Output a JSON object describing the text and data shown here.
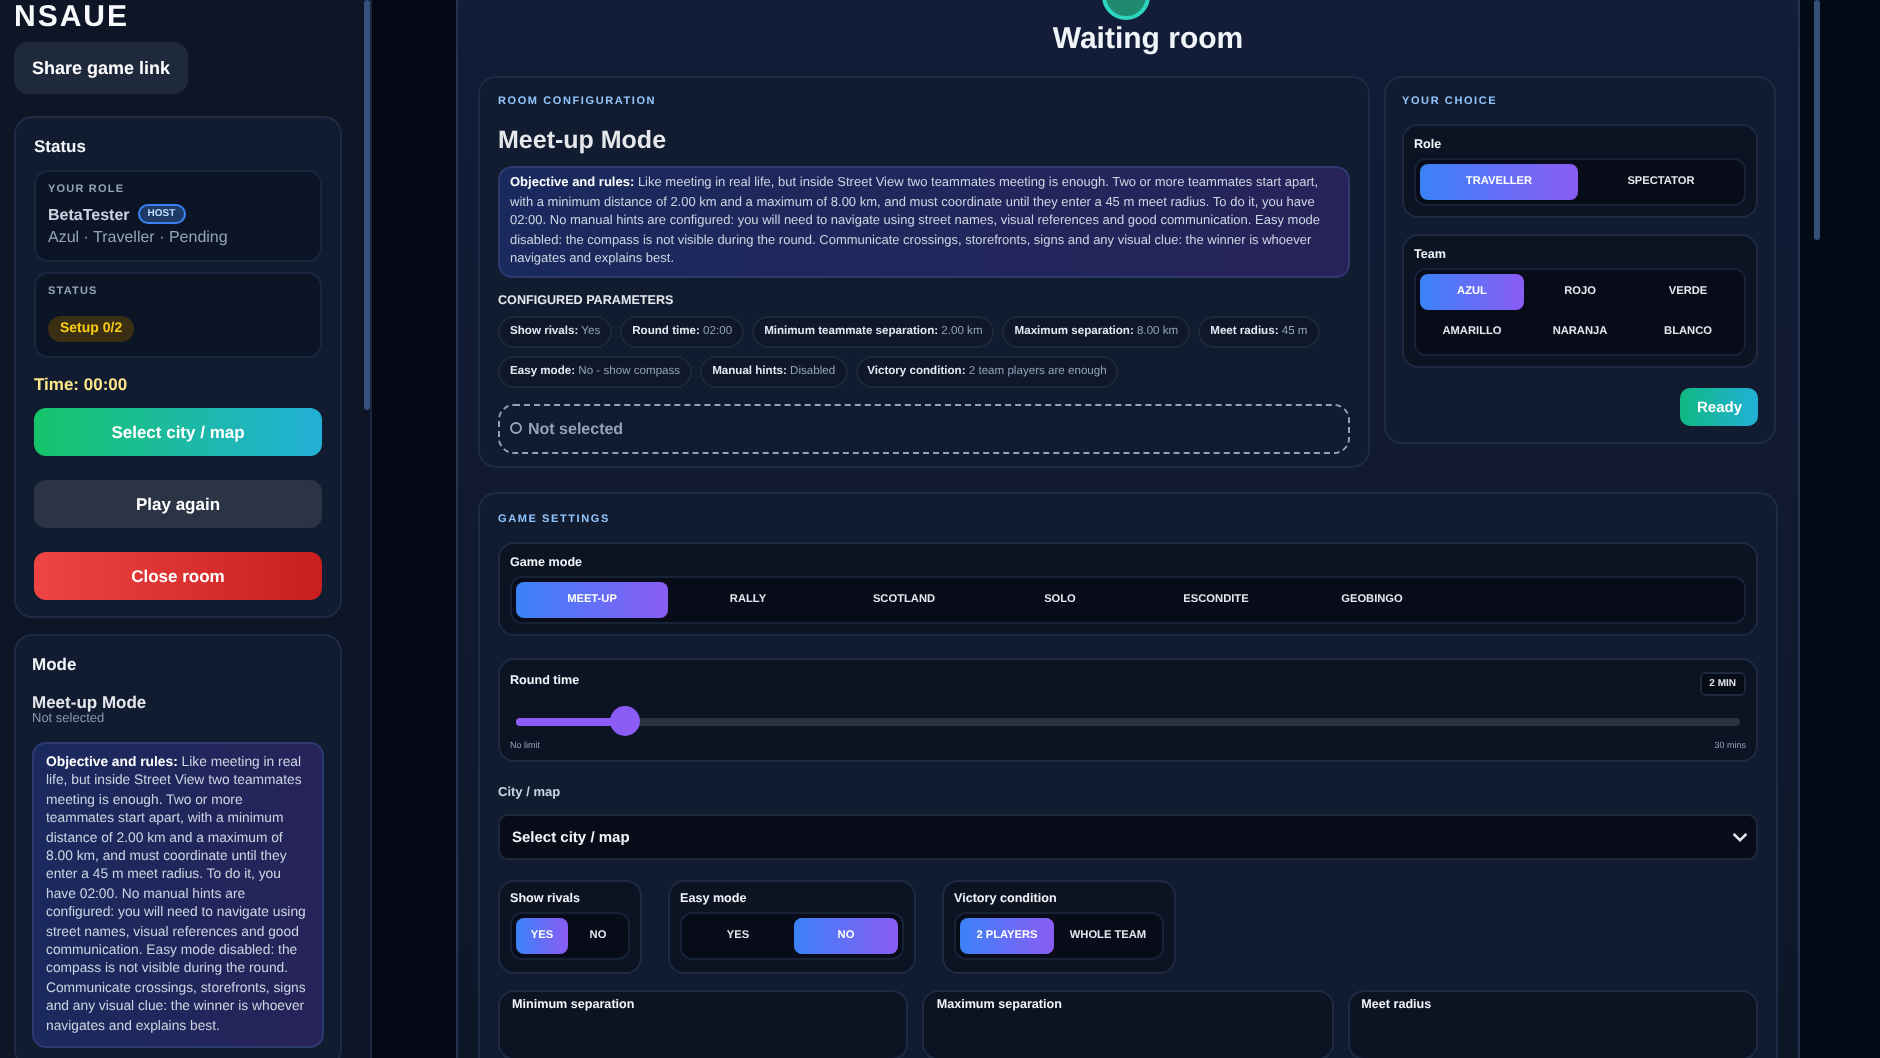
{
  "sidebar": {
    "logo": "NSAUE",
    "share_button": "Share game link",
    "status": {
      "title": "Status",
      "role_label": "YOUR ROLE",
      "player": "BetaTester",
      "badge": "HOST",
      "role_detail": "Azul · Traveller · Pending",
      "status_label": "STATUS",
      "status_value": "Setup 0/2",
      "time": "Time: 00:00"
    },
    "actions": [
      {
        "label": "Select city / map",
        "kind": "primary"
      },
      {
        "label": "Play again",
        "kind": "secondary"
      },
      {
        "label": "Close room",
        "kind": "danger"
      }
    ],
    "mode": {
      "title": "Mode",
      "name": "Meet-up Mode",
      "subtitle": "Not selected",
      "rules": "**Objective and rules:** Like meeting in real life, but inside Street View two teammates meeting is enough. Two or more teammates start apart, with a minimum distance of 2.00 km and a maximum of 8.00 km, and must coordinate until they enter a 45 m meet radius. To do it, you have 02:00. No manual hints are configured: you will need to navigate using street names, visual references and good communication. Easy mode disabled: the compass is not visible during the round. Communicate crossings, storefronts, signs and any visual clue: the winner is whoever navigates and explains best."
    }
  },
  "header": {
    "title": "Waiting room"
  },
  "room_config": {
    "label": "ROOM CONFIGURATION",
    "title": "Meet-up Mode",
    "rules": "**Objective and rules:** Like meeting in real life, but inside Street View two teammates meeting is enough. Two or more teammates start apart, with a minimum distance of 2.00 km and a maximum of 8.00 km, and must coordinate until they enter a 45 m meet radius. To do it, you have 02:00. No manual hints are configured: you will need to navigate using street names, visual references and good communication. Easy mode disabled: the compass is not visible during the round. Communicate crossings, storefronts, signs and any visual clue: the winner is whoever navigates and explains best.",
    "params_title": "CONFIGURED PARAMETERS",
    "params": [
      {
        "key": "Show rivals:",
        "value": "Yes"
      },
      {
        "key": "Round time:",
        "value": "02:00"
      },
      {
        "key": "Minimum teammate separation:",
        "value": "2.00 km"
      },
      {
        "key": "Maximum separation:",
        "value": "8.00 km"
      },
      {
        "key": "Meet radius:",
        "value": "45 m"
      },
      {
        "key": "Easy mode:",
        "value": "No - show compass"
      },
      {
        "key": "Manual hints:",
        "value": "Disabled"
      },
      {
        "key": "Victory condition:",
        "value": "2 team players are enough"
      }
    ],
    "selection": "Not selected"
  },
  "your_choice": {
    "label": "YOUR CHOICE",
    "role": {
      "title": "Role",
      "options": [
        {
          "label": "TRAVELLER",
          "selected": true
        },
        {
          "label": "SPECTATOR",
          "selected": false
        }
      ]
    },
    "team": {
      "title": "Team",
      "options": [
        {
          "label": "AZUL",
          "selected": true
        },
        {
          "label": "ROJO",
          "selected": false
        },
        {
          "label": "VERDE",
          "selected": false
        },
        {
          "label": "AMARILLO",
          "selected": false
        },
        {
          "label": "NARANJA",
          "selected": false
        },
        {
          "label": "BLANCO",
          "selected": false
        }
      ]
    },
    "ready_button": "Ready"
  },
  "game_settings": {
    "label": "GAME SETTINGS",
    "game_mode": {
      "title": "Game mode",
      "options": [
        {
          "label": "MEET-UP",
          "selected": true
        },
        {
          "label": "RALLY",
          "selected": false
        },
        {
          "label": "SCOTLAND",
          "selected": false
        },
        {
          "label": "SOLO",
          "selected": false
        },
        {
          "label": "ESCONDITE",
          "selected": false
        },
        {
          "label": "GEOBINGO",
          "selected": false
        }
      ]
    },
    "round_time": {
      "title": "Round time",
      "value": "2 MIN",
      "level": 0.08,
      "min_label": "No limit",
      "max_label": "30 mins"
    },
    "city": {
      "label": "City / map",
      "value": "Select city / map"
    },
    "toggles": [
      {
        "title": "Show rivals",
        "options": [
          {
            "label": "YES",
            "selected": true
          },
          {
            "label": "NO",
            "selected": false
          }
        ]
      },
      {
        "title": "Easy mode",
        "options": [
          {
            "label": "YES",
            "selected": false
          },
          {
            "label": "NO",
            "selected": true
          }
        ]
      },
      {
        "title": "Victory condition",
        "options": [
          {
            "label": "2 PLAYERS",
            "selected": true
          },
          {
            "label": "WHOLE TEAM",
            "selected": false
          }
        ]
      }
    ],
    "bottom_cards": [
      {
        "title": "Minimum separation"
      },
      {
        "title": "Maximum separation"
      },
      {
        "title": "Meet radius"
      }
    ]
  }
}
